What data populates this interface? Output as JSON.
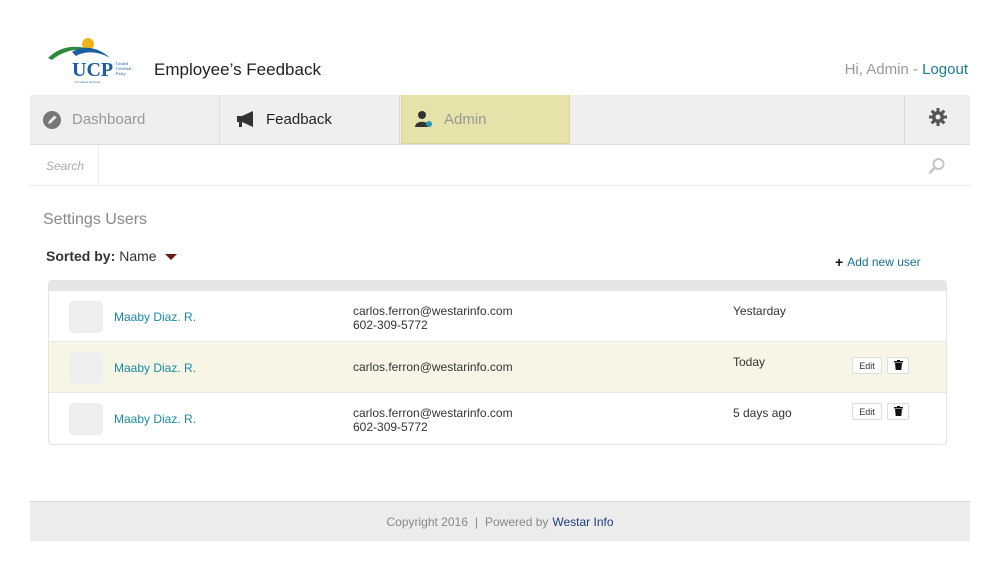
{
  "header": {
    "logo_text": "UCP",
    "logo_subtext": "United Cerebral Palsy of Central Arizona",
    "app_title": "Employee’s Feedback",
    "greeting": "Hi, Admin -",
    "logout_label": "Logout"
  },
  "nav": {
    "items": [
      {
        "label": "Dashboard",
        "icon": "pencil-circle-icon",
        "active": false
      },
      {
        "label": "Feadback",
        "icon": "megaphone-icon",
        "active": false
      },
      {
        "label": "Admin",
        "icon": "user-admin-icon",
        "active": true
      }
    ],
    "settings_icon": "gear-icon"
  },
  "search": {
    "label": "Search",
    "value": "",
    "icon": "search-icon"
  },
  "section": {
    "title": "Settings Users",
    "sorted_label": "Sorted by:",
    "sorted_value": "Name",
    "add_user_label": "Add new user"
  },
  "users": [
    {
      "name": "Maaby Diaz. R.",
      "email": "carlos.ferron@westarinfo.com",
      "phone": "602-309-5772",
      "date": "Yestarday",
      "actions": false,
      "highlight": false
    },
    {
      "name": "Maaby Diaz. R.",
      "email": "carlos.ferron@westarinfo.com",
      "phone": "",
      "date": "Today",
      "actions": true,
      "highlight": true
    },
    {
      "name": "Maaby Diaz. R.",
      "email": "carlos.ferron@westarinfo.com",
      "phone": "602-309-5772",
      "date": "5 days ago",
      "actions": true,
      "highlight": false
    }
  ],
  "row_actions": {
    "edit_label": "Edit",
    "delete_icon": "trash-icon"
  },
  "footer": {
    "copyright": "Copyright 2016",
    "separator": "|",
    "powered_by": "Powered by",
    "link": "Westar Info"
  },
  "colors": {
    "accent": "#1a7a93",
    "admin_tab": "#e6e3aa",
    "highlight_row": "#f7f6e6"
  }
}
